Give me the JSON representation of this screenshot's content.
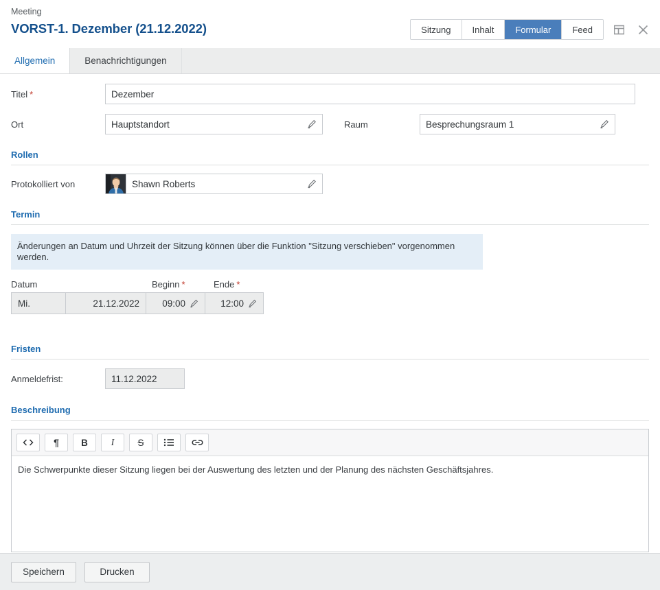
{
  "header": {
    "kicker": "Meeting",
    "title": "VORST-1. Dezember (21.12.2022)",
    "segmented": [
      {
        "label": "Sitzung",
        "active": false
      },
      {
        "label": "Inhalt",
        "active": false
      },
      {
        "label": "Formular",
        "active": true
      },
      {
        "label": "Feed",
        "active": false
      }
    ],
    "panel_icon": "panel-layout-icon",
    "close_icon": "close-icon"
  },
  "tabs": [
    {
      "label": "Allgemein",
      "active": true
    },
    {
      "label": "Benachrichtigungen",
      "active": false
    }
  ],
  "form": {
    "titel": {
      "label": "Titel",
      "required": "*",
      "value": "Dezember"
    },
    "ort": {
      "label": "Ort",
      "value": "Hauptstandort"
    },
    "raum": {
      "label": "Raum",
      "value": "Besprechungsraum 1"
    }
  },
  "rollen": {
    "section_title": "Rollen",
    "protokolliert": {
      "label": "Protokolliert von",
      "value": "Shawn Roberts"
    }
  },
  "termin": {
    "section_title": "Termin",
    "banner": "Änderungen an Datum und Uhrzeit der Sitzung können über die Funktion \"Sitzung verschieben\" vorgenommen werden.",
    "headers": {
      "datum": "Datum",
      "beginn": "Beginn",
      "ende": "Ende",
      "required": "*"
    },
    "weekday": "Mi.",
    "date": "21.12.2022",
    "start": "09:00",
    "end": "12:00"
  },
  "fristen": {
    "section_title": "Fristen",
    "anmeldefrist": {
      "label": "Anmeldefrist:",
      "value": "11.12.2022"
    }
  },
  "beschreibung": {
    "section_title": "Beschreibung",
    "toolbar": [
      {
        "name": "source-code-icon",
        "glyph": "<>"
      },
      {
        "name": "pilcrow-icon",
        "glyph": "¶"
      },
      {
        "name": "bold-icon",
        "glyph": "B"
      },
      {
        "name": "italic-icon",
        "glyph": "I"
      },
      {
        "name": "strikethrough-icon",
        "glyph": "S"
      },
      {
        "name": "bullet-list-icon",
        "glyph": "≔"
      },
      {
        "name": "link-icon",
        "glyph": "🔗"
      }
    ],
    "content": "Die Schwerpunkte dieser Sitzung liegen bei der Auswertung des letzten und der Planung des nächsten Geschäftsjahres."
  },
  "footer": {
    "save": "Speichern",
    "print": "Drucken"
  },
  "colors": {
    "accent": "#4a7ebb",
    "heading": "#14508c",
    "section_heading": "#1f6cb0",
    "required": "#c0392b",
    "banner_bg": "#e4eef7"
  }
}
